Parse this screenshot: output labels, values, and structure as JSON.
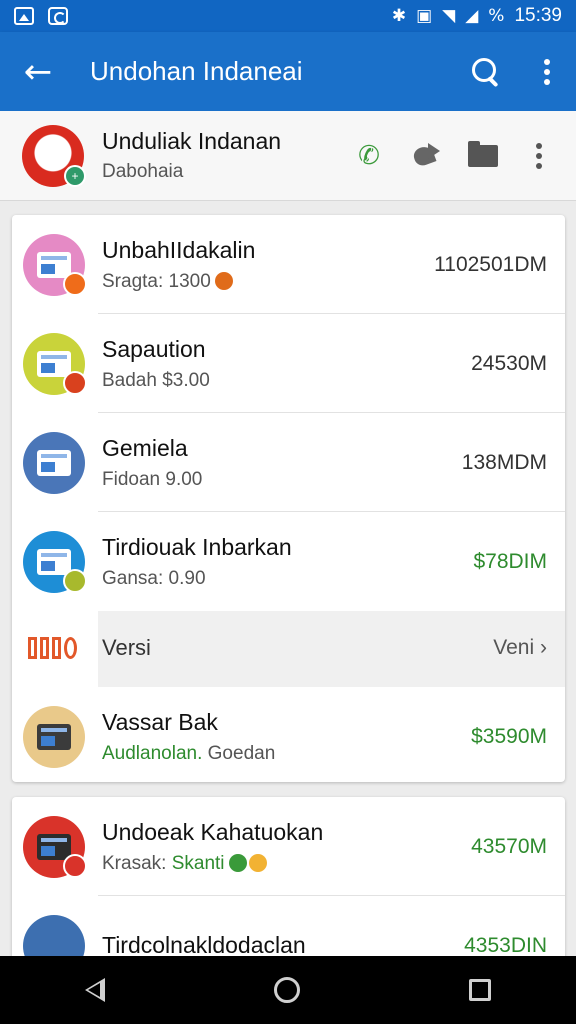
{
  "status_bar": {
    "time": "15:39",
    "battery_text": "%",
    "icons": [
      "image-icon",
      "camera-icon",
      "bluetooth-icon",
      "nfc-icon",
      "wifi-icon",
      "signal-icon",
      "battery-icon"
    ]
  },
  "app_bar": {
    "back_icon": "←",
    "title": "Undohan Indaneai"
  },
  "contact": {
    "name": "Unduliak Indanan",
    "subtitle": "Dabohaia"
  },
  "list": [
    {
      "title": "UnbahIIdakalin",
      "subtitle": "Sragta: 1300",
      "value": "1102501DM",
      "value_color": "#333333",
      "icon_bg": "#e58ac5",
      "mini_bg": "#ef6c1a",
      "dot_color": "#e06b1a"
    },
    {
      "title": "Sapaution",
      "subtitle": "Badah $3.00",
      "value": "24530M",
      "value_color": "#333333",
      "icon_bg": "#c9d33a",
      "mini_bg": "#d9411e"
    },
    {
      "title": "Gemiela",
      "subtitle": "Fidoan 9.00",
      "value": "138MDM",
      "value_color": "#333333",
      "icon_bg": "#4a76b8",
      "mini_bg": ""
    },
    {
      "title": "Tirdiouak Inbarkan",
      "subtitle": "Gansa: 0.90",
      "value": "$78DIM",
      "value_color": "#2e8b2e",
      "icon_bg": "#1e8ed6",
      "mini_bg": "#a8b92d"
    }
  ],
  "versi": {
    "label": "Versi",
    "right_label": "Veni",
    "chevron": "›"
  },
  "list_after": [
    {
      "title": "Vassar Bak",
      "subtitle_green": "Audlanolan.",
      "subtitle_rest": " Goedan",
      "value": "$3590M",
      "value_color": "#2e8b2e",
      "icon_bg": "#e9c98a"
    }
  ],
  "card2": [
    {
      "title": "Undoeak Kahatuokan",
      "subtitle": "Krasak: ",
      "subtitle_green": "Skanti",
      "value": "43570M",
      "value_color": "#2e8b2e",
      "icon_bg": "#d9332a",
      "mini_bg": "#d9332a"
    },
    {
      "title": "Tirdcolnakldodaclan",
      "subtitle": "",
      "value": "4353DIN",
      "value_color": "#2e8b2e",
      "icon_bg": "#3d6fb0"
    }
  ]
}
